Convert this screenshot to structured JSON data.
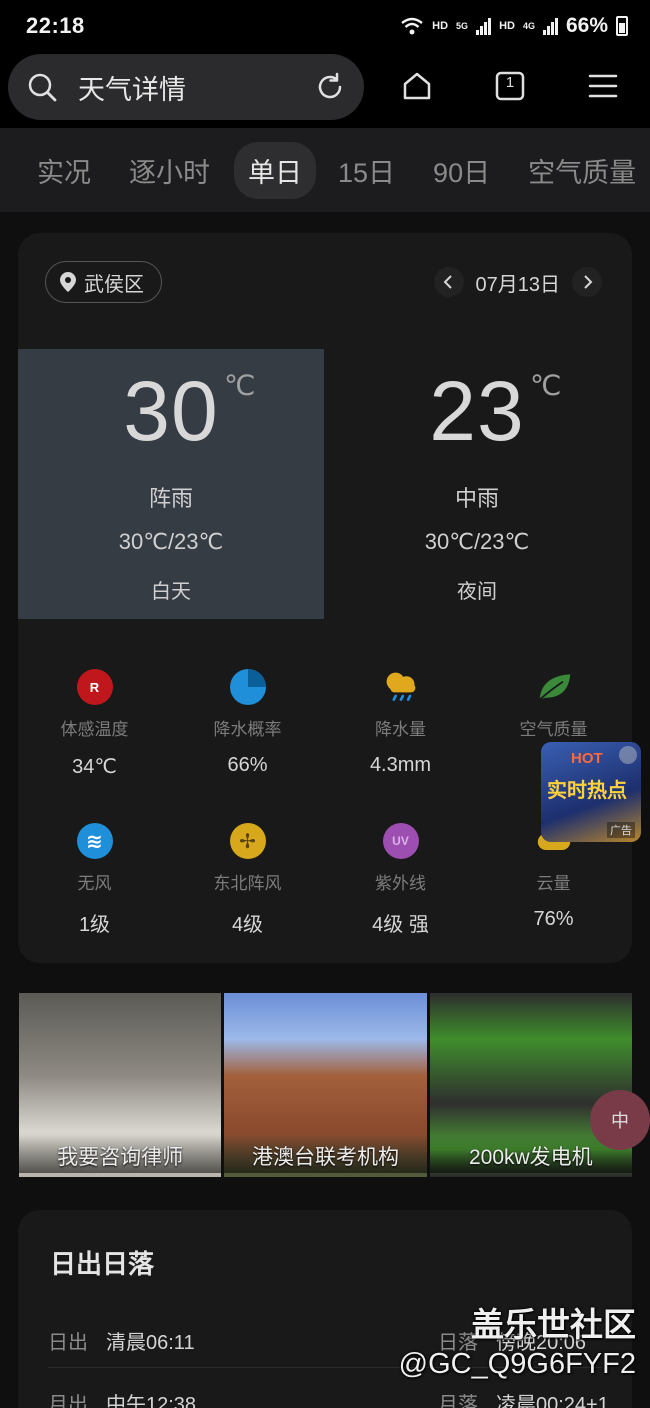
{
  "status_bar": {
    "time": "22:18",
    "hd1": "HD",
    "net1": "5G",
    "hd2": "HD",
    "net2": "4G",
    "battery": "66%"
  },
  "top_bar": {
    "title": "天气详情",
    "tab_count": "1"
  },
  "tabs": [
    "实况",
    "逐小时",
    "单日",
    "15日",
    "90日",
    "空气质量"
  ],
  "active_tab": "单日",
  "location": "武侯区",
  "date": "07月13日",
  "day": {
    "temp": "30",
    "unit": "℃",
    "condition": "阵雨",
    "range": "30℃/23℃",
    "label": "白天"
  },
  "night": {
    "temp": "23",
    "unit": "℃",
    "condition": "中雨",
    "range": "30℃/23℃",
    "label": "夜间"
  },
  "metrics": [
    {
      "label": "体感温度",
      "value": "34℃",
      "icon": "feels-like-icon",
      "glyph": "R",
      "color": "#c0171c"
    },
    {
      "label": "降水概率",
      "value": "66%",
      "icon": "precip-probability-icon",
      "glyph": "",
      "color": "#1e8fd8"
    },
    {
      "label": "降水量",
      "value": "4.3mm",
      "icon": "rain-cloud-icon",
      "glyph": "",
      "color": "#e0a81c"
    },
    {
      "label": "空气质量",
      "value": "",
      "icon": "leaf-icon",
      "glyph": "",
      "color": "#3a8a3a"
    },
    {
      "label": "无风",
      "value": "1级",
      "icon": "wind-icon",
      "glyph": "≋",
      "color": "#1e8fd8"
    },
    {
      "label": "东北阵风",
      "value": "4级",
      "icon": "fan-icon",
      "glyph": "✢",
      "color": "#d8a81c"
    },
    {
      "label": "紫外线",
      "value": "4级 强",
      "icon": "uv-icon",
      "glyph": "UV",
      "color": "#9c4fb0"
    },
    {
      "label": "云量",
      "value": "76%",
      "icon": "cloud-icon",
      "glyph": "",
      "color": "#d8a81c"
    }
  ],
  "ad_float": {
    "hot": "HOT",
    "text": "实时热点",
    "tag": "广告"
  },
  "banners": [
    {
      "caption": "我要咨询律师"
    },
    {
      "caption": "港澳台联考机构"
    },
    {
      "caption": "200kw发电机"
    }
  ],
  "sun": {
    "title": "日出日落",
    "sunrise_label": "日出",
    "sunrise_value": "清晨06:11",
    "sunset_label": "日落",
    "sunset_value": "傍晚20:06",
    "moonrise_label": "月出",
    "moonrise_value": "中午12:38",
    "moonset_label": "月落",
    "moonset_value": "凌晨00:24+1"
  },
  "watermark": {
    "line1": "盖乐世社区",
    "line2": "@GC_Q9G6FYF2"
  }
}
